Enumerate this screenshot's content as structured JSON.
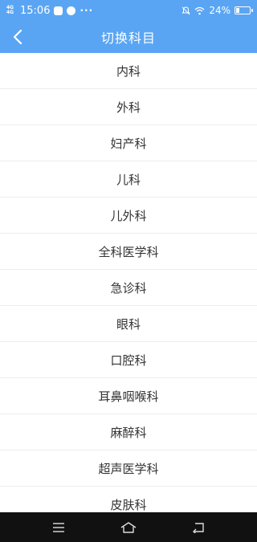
{
  "status_bar": {
    "network": "4G\n4G",
    "time": "15:06",
    "dots": "···",
    "battery_text": "24%",
    "battery_level": 0.24
  },
  "header": {
    "title": "切换科目"
  },
  "departments": [
    "内科",
    "外科",
    "妇产科",
    "儿科",
    "儿外科",
    "全科医学科",
    "急诊科",
    "眼科",
    "口腔科",
    "耳鼻咽喉科",
    "麻醉科",
    "超声医学科",
    "皮肤科"
  ],
  "colors": {
    "accent": "#5aa5f3",
    "nav_bar": "#111111",
    "text": "#333333"
  },
  "icons": {
    "back": "chevron-left-icon",
    "nav_menu": "menu-icon",
    "nav_home": "home-icon",
    "nav_back": "back-arrow-icon"
  }
}
